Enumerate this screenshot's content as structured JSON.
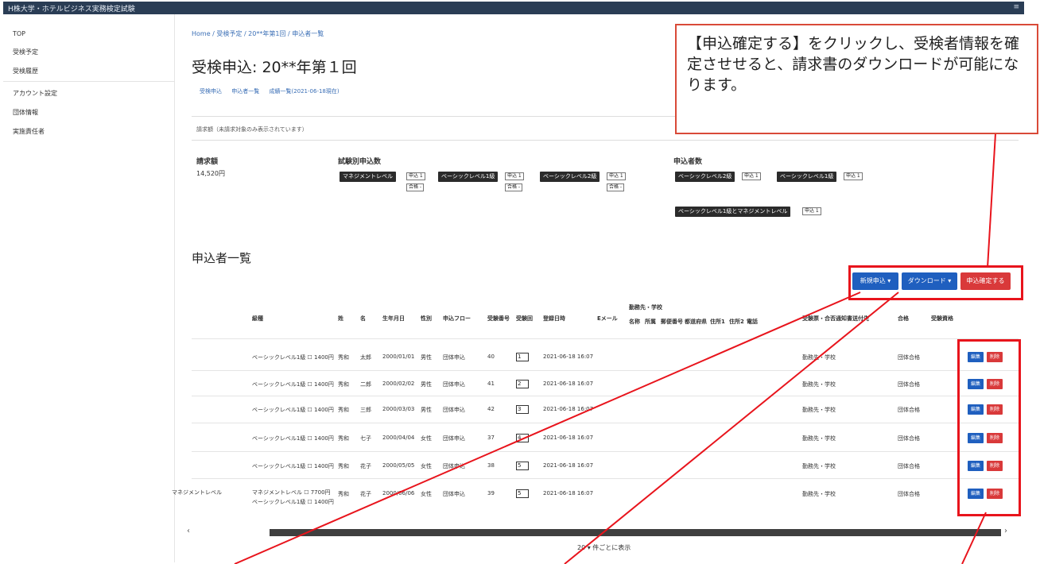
{
  "app": {
    "title": "H株大学・ホテルビジネス実務検定試験",
    "menu_icon": "menu-icon"
  },
  "sidebar": {
    "items": [
      {
        "label": "TOP"
      },
      {
        "label": "受検予定"
      },
      {
        "label": "受検履歴"
      },
      {
        "label": "アカウント設定"
      },
      {
        "label": "団体情報"
      },
      {
        "label": "実施責任者"
      }
    ]
  },
  "breadcrumb": "Home / 受検予定 / 20**年第1回 / 申込者一覧",
  "page_title": "受検申込: 20**年第１回",
  "subtabs": [
    "受検申込",
    "申込者一覧",
    "成績一覧(2021-06-18現在)"
  ],
  "notice": "請求額（未請求対象のみ表示されています）",
  "summary": {
    "billing_label": "請求額",
    "billing_value": "14,520円",
    "by_exam_label": "試験別申込数",
    "by_exam_chips": [
      "マネジメントレベル",
      "ベーシックレベル1級",
      "ベーシックレベル2級"
    ],
    "applicants_label": "申込者数",
    "applicant_chips": [
      "ベーシックレベル2級",
      "ベーシックレベル1級",
      "ベーシックレベル1級とマネジメントレベル"
    ],
    "mini_apply": "申込 1",
    "mini_pass": "合格 -"
  },
  "section_title": "申込者一覧",
  "actions": {
    "new": "新規申込 ▾",
    "download": "ダウンロード ▾",
    "confirm": "申込確定する"
  },
  "table": {
    "headers": [
      "級種",
      "姓",
      "名",
      "生年月日",
      "性別",
      "申込フロー",
      "受験番号",
      "受験回",
      "登録日時",
      "Eメール",
      "勤務先・学校",
      "受験票・合否通知書送付先",
      "合格",
      "受験資格"
    ],
    "subheaders": [
      "名称",
      "所属",
      "郵便番号",
      "都道府県",
      "住所1",
      "住所2",
      "電話"
    ],
    "rows": [
      {
        "level": "ベーシックレベル1級 ☐ 1400円",
        "sei": "秀和",
        "mei": "太郎",
        "dob": "2000/01/01",
        "sex": "男性",
        "flow": "団体申込",
        "no": "40",
        "sel": "1",
        "date": "2021-06-18 16:07",
        "dest": "勤務先・学校",
        "result": "団体合格"
      },
      {
        "level": "ベーシックレベル1級 ☐ 1400円",
        "sei": "秀和",
        "mei": "二郎",
        "dob": "2000/02/02",
        "sex": "男性",
        "flow": "団体申込",
        "no": "41",
        "sel": "2",
        "date": "2021-06-18 16:07",
        "dest": "勤務先・学校",
        "result": "団体合格"
      },
      {
        "level": "ベーシックレベル1級 ☐ 1400円",
        "sei": "秀和",
        "mei": "三郎",
        "dob": "2000/03/03",
        "sex": "男性",
        "flow": "団体申込",
        "no": "42",
        "sel": "3",
        "date": "2021-06-18 16:07",
        "dest": "勤務先・学校",
        "result": "団体合格"
      },
      {
        "level": "ベーシックレベル1級 ☐ 1400円",
        "sei": "秀和",
        "mei": "七子",
        "dob": "2000/04/04",
        "sex": "女性",
        "flow": "団体申込",
        "no": "37",
        "sel": "4",
        "date": "2021-06-18 16:07",
        "dest": "勤務先・学校",
        "result": "団体合格"
      },
      {
        "level": "ベーシックレベル1級 ☐ 1400円",
        "sei": "秀和",
        "mei": "花子",
        "dob": "2000/05/05",
        "sex": "女性",
        "flow": "団体申込",
        "no": "38",
        "sel": "5",
        "date": "2021-06-18 16:07",
        "dest": "勤務先・学校",
        "result": "団体合格"
      },
      {
        "level": "マネジメントレベル ☐ 7700円",
        "level2": "ベーシックレベル1級 ☐ 1400円",
        "prefix": "マネジメントレベル",
        "sei": "秀和",
        "mei": "花子",
        "dob": "2000/06/06",
        "sex": "女性",
        "flow": "団体申込",
        "no": "39",
        "sel": "5",
        "date": "2021-06-18 16:07",
        "dest": "勤務先・学校",
        "result": "団体合格"
      }
    ],
    "row_edit": "編集",
    "row_delete": "削除"
  },
  "pager": "20 ▾ 件ごとに表示",
  "callout": "【申込確定する】をクリックし、受検者情報を確定させせると、請求書のダウンロードが可能になります。",
  "colors": {
    "topbar": "#2a3d55",
    "primary": "#1f5fbf",
    "danger": "#d9393a",
    "highlight": "#e8141c"
  }
}
